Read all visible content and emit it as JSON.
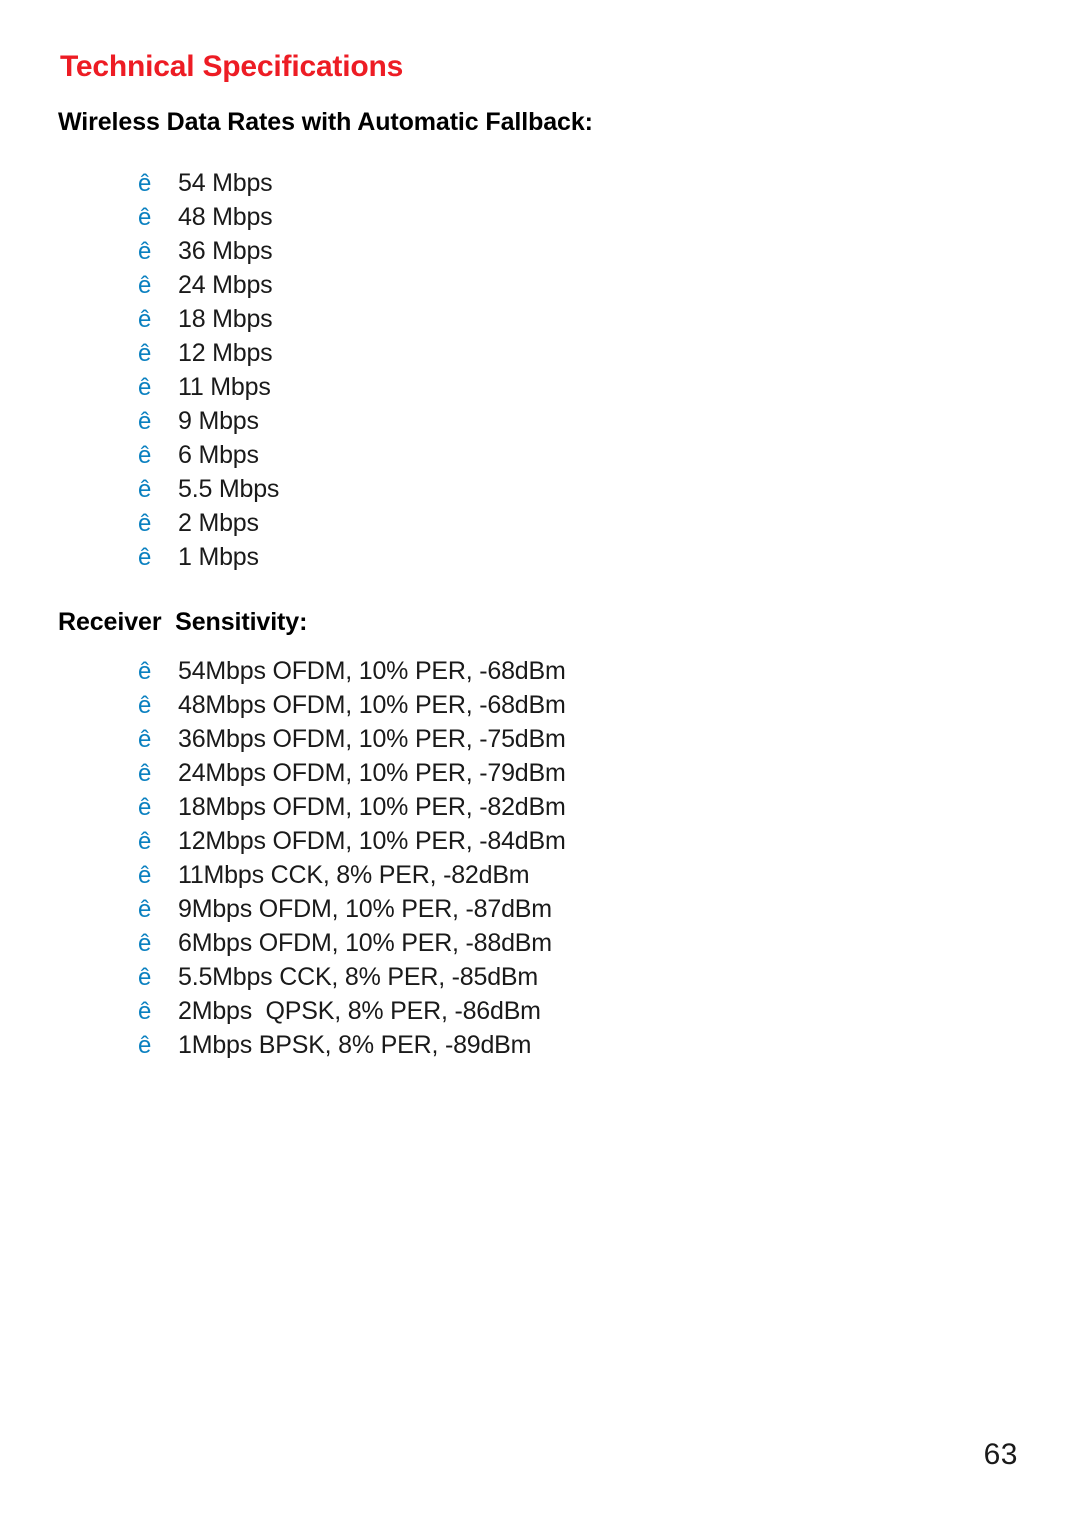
{
  "page": {
    "title": "Technical Specifications",
    "number": "63",
    "accent_red": "#ED1C24",
    "bullet_blue": "#0A80C0",
    "background": "#FFFFFF",
    "text_color": "#1A1A1A"
  },
  "sections": [
    {
      "heading": "Wireless Data Rates with Automatic Fallback:",
      "bullet_glyph": "ê",
      "bullet_icon_name": "arrow-bullet-icon",
      "items": [
        "54 Mbps",
        "48 Mbps",
        "36 Mbps",
        "24 Mbps",
        "18 Mbps",
        "12 Mbps",
        "11 Mbps",
        "9 Mbps",
        "6 Mbps",
        "5.5 Mbps",
        "2 Mbps",
        "1 Mbps"
      ]
    },
    {
      "heading": "Receiver  Sensitivity:",
      "bullet_glyph": "ê",
      "bullet_icon_name": "arrow-bullet-icon",
      "items": [
        "54Mbps OFDM, 10% PER, -68dBm",
        "48Mbps OFDM, 10% PER, -68dBm",
        "36Mbps OFDM, 10% PER, -75dBm",
        "24Mbps OFDM, 10% PER, -79dBm",
        "18Mbps OFDM, 10% PER, -82dBm",
        "12Mbps OFDM, 10% PER, -84dBm",
        "11Mbps CCK, 8% PER, -82dBm",
        "9Mbps OFDM, 10% PER, -87dBm",
        "6Mbps OFDM, 10% PER, -88dBm",
        "5.5Mbps CCK, 8% PER, -85dBm",
        "2Mbps  QPSK, 8% PER, -86dBm",
        "1Mbps BPSK, 8% PER, -89dBm"
      ]
    }
  ]
}
